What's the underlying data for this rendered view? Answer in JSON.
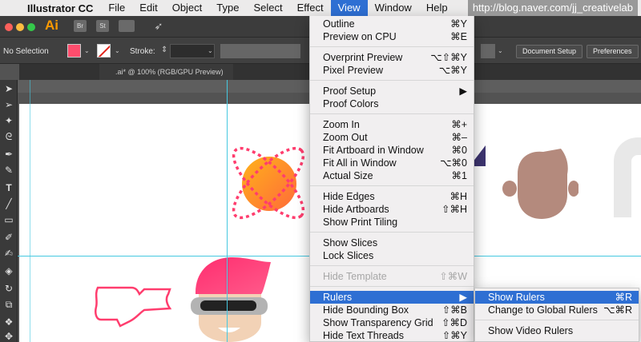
{
  "menubar": {
    "apple": "",
    "app_name": "Illustrator CC",
    "items": [
      "File",
      "Edit",
      "Object",
      "Type",
      "Select",
      "Effect",
      "View",
      "Window",
      "Help"
    ],
    "active": "View"
  },
  "watermark": "http://blog.naver.com/jj_creativelab",
  "app_header": {
    "logo": "Ai",
    "icons": [
      "Br",
      "St",
      "workspace-icon",
      "gpu-icon"
    ]
  },
  "control_bar": {
    "selection_label": "No Selection",
    "stroke_label": "Stroke:",
    "document_setup": "Document Setup",
    "preferences": "Preferences",
    "fill_color": "#ff4d6d"
  },
  "doc_tab": {
    "title": ".ai* @ 100% (RGB/GPU Preview)"
  },
  "view_menu": {
    "items": [
      {
        "label": "Outline",
        "shortcut": "⌘Y"
      },
      {
        "label": "Preview on CPU",
        "shortcut": "⌘E"
      },
      {
        "label": "Overprint Preview",
        "shortcut": "⌥⇧⌘Y"
      },
      {
        "label": "Pixel Preview",
        "shortcut": "⌥⌘Y"
      },
      {
        "label": "Proof Setup",
        "shortcut": "▶"
      },
      {
        "label": "Proof Colors",
        "shortcut": ""
      },
      {
        "label": "Zoom In",
        "shortcut": "⌘+"
      },
      {
        "label": "Zoom Out",
        "shortcut": "⌘–"
      },
      {
        "label": "Fit Artboard in Window",
        "shortcut": "⌘0"
      },
      {
        "label": "Fit All in Window",
        "shortcut": "⌥⌘0"
      },
      {
        "label": "Actual Size",
        "shortcut": "⌘1"
      },
      {
        "label": "Hide Edges",
        "shortcut": "⌘H"
      },
      {
        "label": "Hide Artboards",
        "shortcut": "⇧⌘H"
      },
      {
        "label": "Show Print Tiling",
        "shortcut": ""
      },
      {
        "label": "Show Slices",
        "shortcut": ""
      },
      {
        "label": "Lock Slices",
        "shortcut": ""
      },
      {
        "label": "Hide Template",
        "shortcut": "⇧⌘W"
      },
      {
        "label": "Rulers",
        "shortcut": "▶"
      },
      {
        "label": "Hide Bounding Box",
        "shortcut": "⇧⌘B"
      },
      {
        "label": "Show Transparency Grid",
        "shortcut": "⇧⌘D"
      },
      {
        "label": "Hide Text Threads",
        "shortcut": "⇧⌘Y"
      }
    ]
  },
  "rulers_submenu": {
    "items": [
      {
        "label": "Show Rulers",
        "shortcut": "⌘R"
      },
      {
        "label": "Change to Global Rulers",
        "shortcut": "⌥⌘R"
      },
      {
        "label": "Show Video Rulers",
        "shortcut": ""
      }
    ]
  },
  "colors": {
    "accent": "#2e6fd3",
    "canvas_bg": "#535353",
    "guide": "#45c8e0",
    "art_pink": "#ff3d6e",
    "art_orange": "#ffa21f",
    "art_brown": "#b48a7d"
  }
}
